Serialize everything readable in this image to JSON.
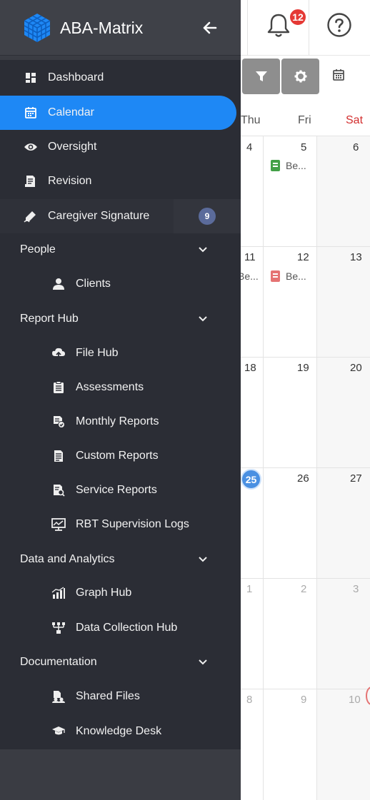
{
  "header": {
    "app_title": "ABA-Matrix",
    "notification_count": "12"
  },
  "sidebar": {
    "items": [
      {
        "label": "Dashboard",
        "icon": "dashboard-icon"
      },
      {
        "label": "Calendar",
        "icon": "calendar-icon",
        "active": true
      },
      {
        "label": "Oversight",
        "icon": "eye-icon"
      },
      {
        "label": "Revision",
        "icon": "document-edit-icon"
      },
      {
        "label": "Caregiver Signature",
        "icon": "signature-pen-icon",
        "badge": "9"
      }
    ],
    "groups": [
      {
        "label": "People",
        "children": [
          {
            "label": "Clients",
            "icon": "person-icon"
          }
        ]
      },
      {
        "label": "Report Hub",
        "children": [
          {
            "label": "File Hub",
            "icon": "cloud-upload-icon"
          },
          {
            "label": "Assessments",
            "icon": "clipboard-icon"
          },
          {
            "label": "Monthly Reports",
            "icon": "report-check-icon"
          },
          {
            "label": "Custom Reports",
            "icon": "document-icon"
          },
          {
            "label": "Service Reports",
            "icon": "report-search-icon"
          },
          {
            "label": "RBT Supervision Logs",
            "icon": "monitor-chart-icon"
          }
        ]
      },
      {
        "label": "Data and Analytics",
        "children": [
          {
            "label": "Graph Hub",
            "icon": "bar-chart-icon"
          },
          {
            "label": "Data Collection Hub",
            "icon": "network-icon"
          }
        ]
      },
      {
        "label": "Documentation",
        "children": [
          {
            "label": "Shared Files",
            "icon": "shared-files-icon"
          },
          {
            "label": "Knowledge Desk",
            "icon": "graduation-cap-icon"
          }
        ]
      }
    ]
  },
  "calendar": {
    "weekdays": [
      "Thu",
      "Fri",
      "Sat"
    ],
    "weeks": [
      {
        "thu": "4",
        "fri": "5",
        "sat": "6"
      },
      {
        "thu": "11",
        "fri": "12",
        "sat": "13"
      },
      {
        "thu": "18",
        "fri": "19",
        "sat": "20"
      },
      {
        "thu": "25",
        "fri": "26",
        "sat": "27"
      },
      {
        "thu": "1",
        "fri": "2",
        "sat": "3"
      },
      {
        "thu": "8",
        "fri": "9",
        "sat": "10"
      }
    ],
    "events": [
      {
        "text": "Be...",
        "color": "#43a047"
      },
      {
        "text": "Be...",
        "color": ""
      },
      {
        "text": "Be...",
        "color": "#e57373"
      }
    ]
  },
  "colors": {
    "accent": "#1e88f5",
    "sidebar_bg": "#2b2d35",
    "badge_red": "#e53935",
    "today": "#4a90e2"
  }
}
